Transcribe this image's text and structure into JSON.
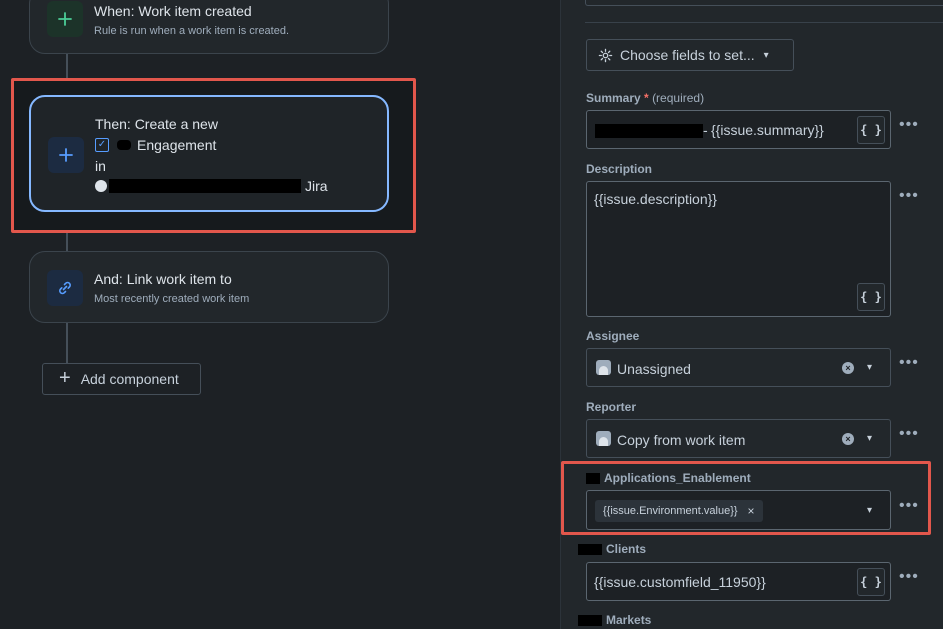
{
  "flow": {
    "trigger": {
      "title": "When: Work item created",
      "subtitle": "Rule is run when a work item is created."
    },
    "action": {
      "line1": "Then: Create a new",
      "issue_type": "Engagement",
      "in_label": "in",
      "project_suffix": "Jira"
    },
    "link": {
      "title": "And: Link work item to",
      "subtitle": "Most recently created work item"
    },
    "add_component": "Add component"
  },
  "panel": {
    "choose_fields": "Choose fields to set...",
    "summary": {
      "label": "Summary",
      "required_mark": "*",
      "required_text": "(required)",
      "value": "{{issue.summary}}",
      "prefix": "-"
    },
    "description": {
      "label": "Description",
      "value": "{{issue.description}}"
    },
    "assignee": {
      "label": "Assignee",
      "value": "Unassigned"
    },
    "reporter": {
      "label": "Reporter",
      "value": "Copy from work item"
    },
    "applications": {
      "label": "Applications_Enablement",
      "tag": "{{issue.Environment.value}}"
    },
    "clients": {
      "label": "Clients",
      "value": "{{issue.customfield_11950}}"
    },
    "markets": {
      "label": "Markets"
    },
    "brace_glyph": "{ }",
    "more_glyph": "•••"
  },
  "colors": {
    "accent": "#85b8ff",
    "highlight": "#e2574c",
    "trigger_icon": "#4bce97",
    "link_icon": "#579dff"
  }
}
